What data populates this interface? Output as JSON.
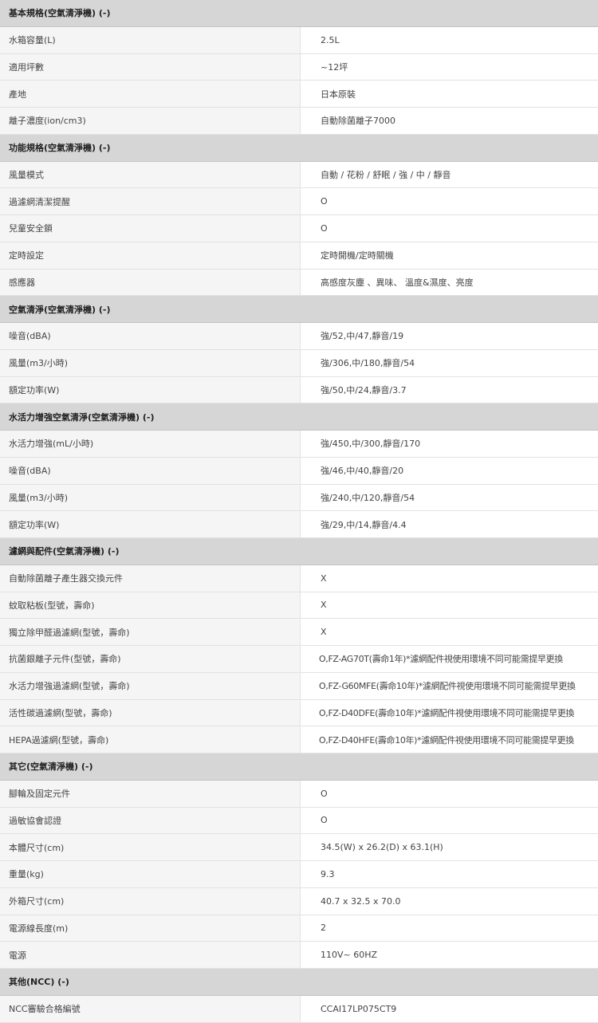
{
  "sections": [
    {
      "title": "基本規格(空氣清淨機) (-)",
      "rows": [
        {
          "label": "水箱容量(L)",
          "value": "2.5L"
        },
        {
          "label": "適用坪數",
          "value": "~12坪"
        },
        {
          "label": "產地",
          "value": "日本原裝"
        },
        {
          "label": "離子濃度(ion/cm3)",
          "value": "自動除菌離子7000"
        }
      ]
    },
    {
      "title": "功能規格(空氣清淨機) (-)",
      "rows": [
        {
          "label": "風量模式",
          "value": "自動 / 花粉 / 舒眠 / 強 / 中 / 靜音"
        },
        {
          "label": "過濾網清潔提醒",
          "value": "O"
        },
        {
          "label": "兒童安全鎖",
          "value": "O"
        },
        {
          "label": "定時設定",
          "value": "定時開機/定時關機"
        },
        {
          "label": "感應器",
          "value": "高感度灰塵 、異味、 溫度&濕度、亮度"
        }
      ]
    },
    {
      "title": "空氣清淨(空氣清淨機) (-)",
      "rows": [
        {
          "label": "噪音(dBA)",
          "value": "強/52,中/47,靜音/19"
        },
        {
          "label": "風量(m3/小時)",
          "value": "強/306,中/180,靜音/54"
        },
        {
          "label": "額定功率(W)",
          "value": "強/50,中/24,靜音/3.7"
        }
      ]
    },
    {
      "title": "水活力增強空氣清淨(空氣清淨機) (-)",
      "rows": [
        {
          "label": "水活力增強(mL/小時)",
          "value": "強/450,中/300,靜音/170"
        },
        {
          "label": "噪音(dBA)",
          "value": "強/46,中/40,靜音/20"
        },
        {
          "label": "風量(m3/小時)",
          "value": "強/240,中/120,靜音/54"
        },
        {
          "label": "額定功率(W)",
          "value": "強/29,中/14,靜音/4.4"
        }
      ]
    },
    {
      "title": "濾網與配件(空氣清淨機) (-)",
      "rows": [
        {
          "label": "自動除菌離子產生器交換元件",
          "value": "X"
        },
        {
          "label": "蚊取粘板(型號，壽命)",
          "value": "X"
        },
        {
          "label": "獨立除甲醛過濾網(型號，壽命)",
          "value": "X"
        },
        {
          "label": "抗菌銀離子元件(型號，壽命)",
          "value": "O,FZ-AG70T(壽命1年)*濾網配件視使用環境不同可能需提早更換"
        },
        {
          "label": "水活力增強過濾網(型號，壽命)",
          "value": "O,FZ-G60MFE(壽命10年)*濾網配件視使用環境不同可能需提早更換"
        },
        {
          "label": "活性碳過濾網(型號，壽命)",
          "value": "O,FZ-D40DFE(壽命10年)*濾網配件視使用環境不同可能需提早更換"
        },
        {
          "label": "HEPA過濾網(型號，壽命)",
          "value": "O,FZ-D40HFE(壽命10年)*濾網配件視使用環境不同可能需提早更換"
        }
      ]
    },
    {
      "title": "其它(空氣清淨機) (-)",
      "rows": [
        {
          "label": "腳輪及固定元件",
          "value": "O"
        },
        {
          "label": "過敏協會認證",
          "value": "O"
        },
        {
          "label": "本體尺寸(cm)",
          "value": "34.5(W) x 26.2(D) x 63.1(H)"
        },
        {
          "label": "重量(kg)",
          "value": "9.3"
        },
        {
          "label": "外箱尺寸(cm)",
          "value": "40.7 x 32.5 x 70.0"
        },
        {
          "label": "電源線長度(m)",
          "value": "2"
        },
        {
          "label": "電源",
          "value": "110V~ 60HZ"
        }
      ]
    },
    {
      "title": "其他(NCC) (-)",
      "rows": [
        {
          "label": "NCC審驗合格編號",
          "value": "CCAI17LP075CT9"
        }
      ]
    }
  ]
}
